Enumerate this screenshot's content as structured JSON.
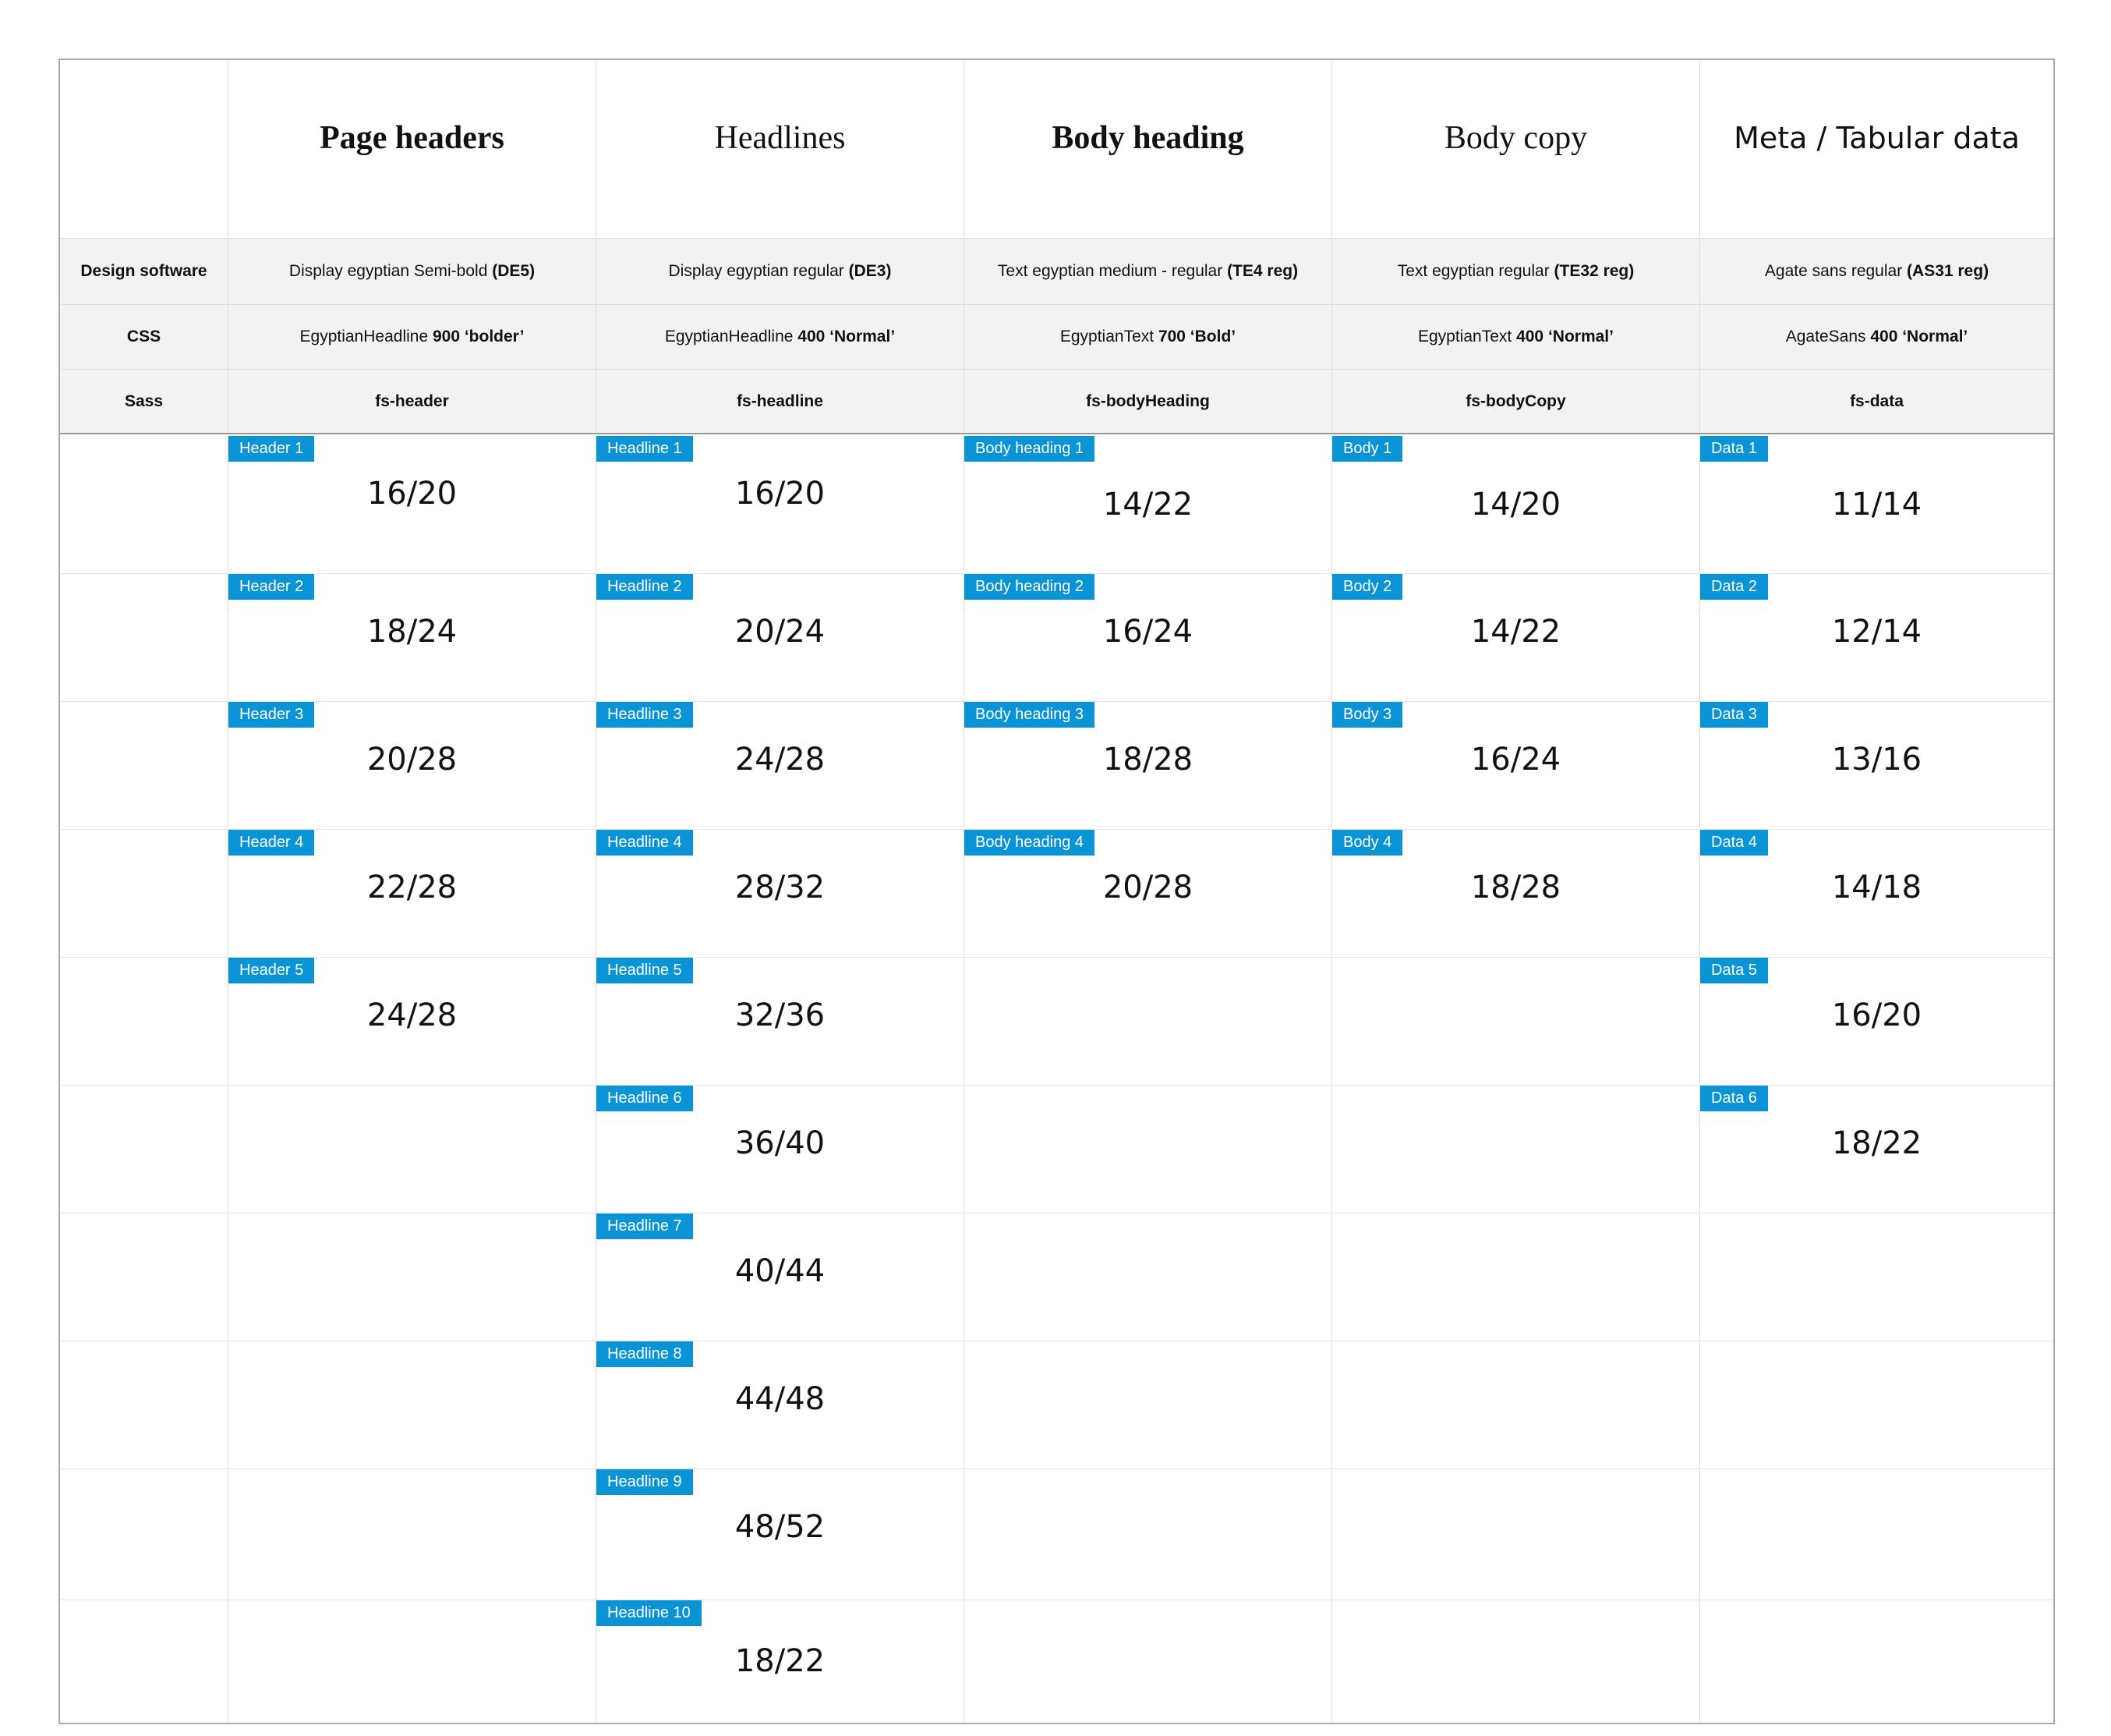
{
  "columns": [
    {
      "title": "Page headers"
    },
    {
      "title": "Headlines"
    },
    {
      "title": "Body heading"
    },
    {
      "title": "Body copy"
    },
    {
      "title": "Meta / Tabular data"
    }
  ],
  "info_rows": [
    {
      "label": "Design software",
      "cells": [
        {
          "text": "Display egyptian Semi-bold ",
          "strong": "(DE5)"
        },
        {
          "text": "Display egyptian regular ",
          "strong": "(DE3)"
        },
        {
          "text": "Text egyptian medium - regular ",
          "strong": "(TE4 reg)"
        },
        {
          "text": "Text egyptian regular ",
          "strong": "(TE32 reg)"
        },
        {
          "text": "Agate sans regular ",
          "strong": "(AS31 reg)"
        }
      ]
    },
    {
      "label": "CSS",
      "cells": [
        {
          "text": "EgyptianHeadline ",
          "strong": "900 ‘bolder’"
        },
        {
          "text": "EgyptianHeadline ",
          "strong": "400 ‘Normal’"
        },
        {
          "text": "EgyptianText ",
          "strong": "700 ‘Bold’"
        },
        {
          "text": "EgyptianText ",
          "strong": "400 ‘Normal’"
        },
        {
          "text": "AgateSans ",
          "strong": "400 ‘Normal’"
        }
      ]
    },
    {
      "label": "Sass",
      "cells": [
        {
          "text": "",
          "strong": "fs-header"
        },
        {
          "text": "",
          "strong": "fs-headline"
        },
        {
          "text": "",
          "strong": "fs-bodyHeading"
        },
        {
          "text": "",
          "strong": "fs-bodyCopy"
        },
        {
          "text": "",
          "strong": "fs-data"
        }
      ]
    }
  ],
  "size_rows": [
    {
      "cells": [
        {
          "tag": "Header 1",
          "value": "16/20"
        },
        {
          "tag": "Headline 1",
          "value": "16/20"
        },
        {
          "tag": "Body heading 1",
          "value": "14/22"
        },
        {
          "tag": "Body 1",
          "value": "14/20"
        },
        {
          "tag": "Data 1",
          "value": "11/14"
        }
      ]
    },
    {
      "cells": [
        {
          "tag": "Header 2",
          "value": "18/24"
        },
        {
          "tag": "Headline 2",
          "value": "20/24"
        },
        {
          "tag": "Body heading 2",
          "value": "16/24"
        },
        {
          "tag": "Body 2",
          "value": "14/22"
        },
        {
          "tag": "Data 2",
          "value": "12/14"
        }
      ]
    },
    {
      "cells": [
        {
          "tag": "Header 3",
          "value": "20/28"
        },
        {
          "tag": "Headline 3",
          "value": "24/28"
        },
        {
          "tag": "Body heading 3",
          "value": "18/28"
        },
        {
          "tag": "Body 3",
          "value": "16/24"
        },
        {
          "tag": "Data 3",
          "value": "13/16"
        }
      ]
    },
    {
      "cells": [
        {
          "tag": "Header 4",
          "value": "22/28"
        },
        {
          "tag": "Headline 4",
          "value": "28/32"
        },
        {
          "tag": "Body heading 4",
          "value": "20/28"
        },
        {
          "tag": "Body 4",
          "value": "18/28"
        },
        {
          "tag": "Data 4",
          "value": "14/18"
        }
      ]
    },
    {
      "cells": [
        {
          "tag": "Header 5",
          "value": "24/28"
        },
        {
          "tag": "Headline 5",
          "value": "32/36"
        },
        null,
        null,
        {
          "tag": "Data 5",
          "value": "16/20"
        }
      ]
    },
    {
      "cells": [
        null,
        {
          "tag": "Headline 6",
          "value": "36/40"
        },
        null,
        null,
        {
          "tag": "Data 6",
          "value": "18/22"
        }
      ]
    },
    {
      "cells": [
        null,
        {
          "tag": "Headline 7",
          "value": "40/44"
        },
        null,
        null,
        null
      ]
    },
    {
      "cells": [
        null,
        {
          "tag": "Headline 8",
          "value": "44/48"
        },
        null,
        null,
        null
      ]
    },
    {
      "cells": [
        null,
        {
          "tag": "Headline 9",
          "value": "48/52"
        },
        null,
        null,
        null
      ]
    },
    {
      "cells": [
        null,
        {
          "tag": "Headline 10",
          "value": "18/22"
        },
        null,
        null,
        null
      ]
    }
  ],
  "colors": {
    "tag_bg": "#0a93d5",
    "tag_text": "#ffffff",
    "info_bg": "#f2f2f2",
    "border": "#a9a9a9"
  }
}
